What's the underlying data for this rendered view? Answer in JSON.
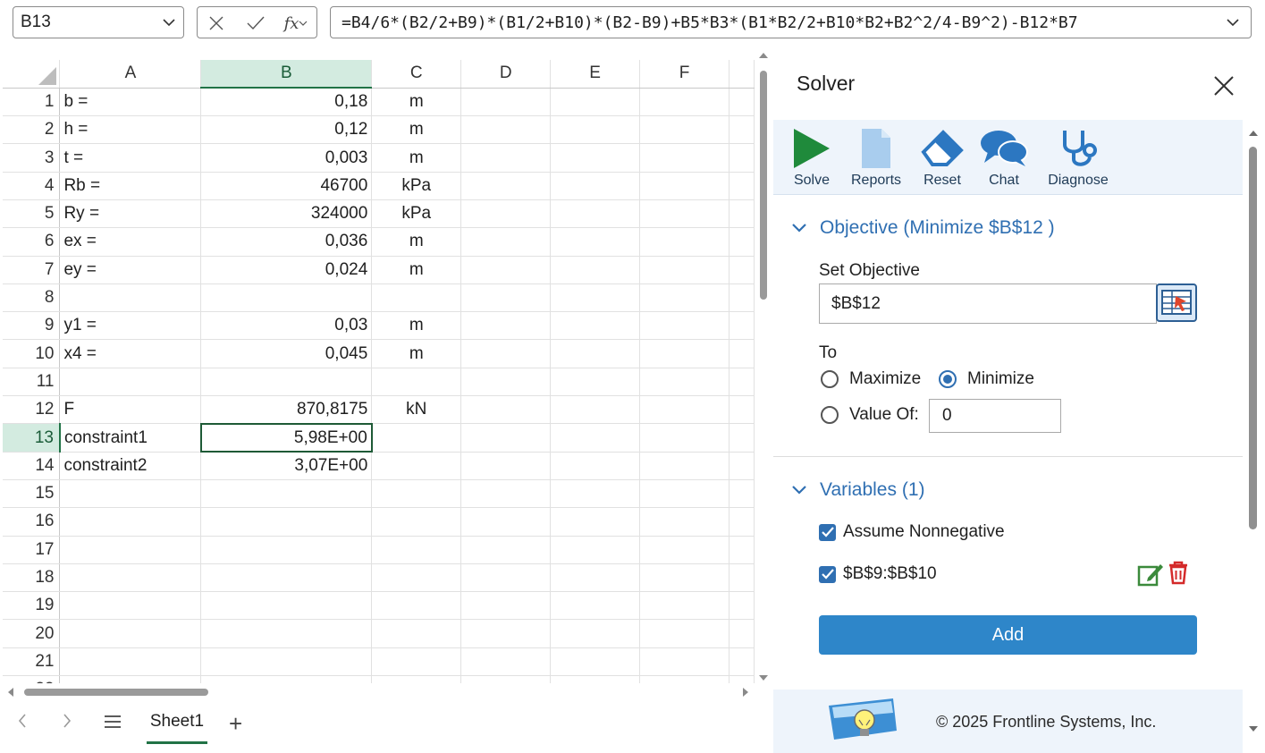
{
  "name_box": "B13",
  "formula_bar": {
    "fx_label": "fx",
    "formula": "=B4/6*(B2/2+B9)*(B1/2+B10)*(B2-B9)+B5*B3*(B1*B2/2+B10*B2+B2^2/4-B9^2)-B12*B7"
  },
  "grid": {
    "columns": [
      "A",
      "B",
      "C",
      "D",
      "E",
      "F"
    ],
    "selected_column": "B",
    "selected_row": 13,
    "rows": [
      {
        "n": "1",
        "a": "b =",
        "b": "0,18",
        "c": "m"
      },
      {
        "n": "2",
        "a": "h =",
        "b": "0,12",
        "c": "m"
      },
      {
        "n": "3",
        "a": "t =",
        "b": "0,003",
        "c": "m"
      },
      {
        "n": "4",
        "a": "Rb =",
        "b": "46700",
        "c": "kPa"
      },
      {
        "n": "5",
        "a": "Ry =",
        "b": "324000",
        "c": "kPa"
      },
      {
        "n": "6",
        "a": "ex =",
        "b": "0,036",
        "c": "m"
      },
      {
        "n": "7",
        "a": "ey =",
        "b": "0,024",
        "c": "m"
      },
      {
        "n": "8",
        "a": "",
        "b": "",
        "c": ""
      },
      {
        "n": "9",
        "a": "y1 =",
        "b": "0,03",
        "c": "m"
      },
      {
        "n": "10",
        "a": "x4 =",
        "b": "0,045",
        "c": "m"
      },
      {
        "n": "11",
        "a": "",
        "b": "",
        "c": ""
      },
      {
        "n": "12",
        "a": "F",
        "b": "870,8175",
        "c": "kN"
      },
      {
        "n": "13",
        "a": "constraint1",
        "b": "5,98E+00",
        "c": ""
      },
      {
        "n": "14",
        "a": "constraint2",
        "b": "3,07E+00",
        "c": ""
      },
      {
        "n": "15",
        "a": "",
        "b": "",
        "c": ""
      },
      {
        "n": "16",
        "a": "",
        "b": "",
        "c": ""
      },
      {
        "n": "17",
        "a": "",
        "b": "",
        "c": ""
      },
      {
        "n": "18",
        "a": "",
        "b": "",
        "c": ""
      },
      {
        "n": "19",
        "a": "",
        "b": "",
        "c": ""
      },
      {
        "n": "20",
        "a": "",
        "b": "",
        "c": ""
      },
      {
        "n": "21",
        "a": "",
        "b": "",
        "c": ""
      },
      {
        "n": "22",
        "a": "",
        "b": "",
        "c": ""
      }
    ]
  },
  "sheet_tabs": {
    "active": "Sheet1",
    "add": "+"
  },
  "solver": {
    "title": "Solver",
    "toolbar": [
      "Solve",
      "Reports",
      "Reset",
      "Chat",
      "Diagnose"
    ],
    "objective_header": "Objective (Minimize $B$12 )",
    "set_objective_label": "Set Objective",
    "objective_value": "$B$12",
    "to_label": "To",
    "maximize": "Maximize",
    "minimize": "Minimize",
    "value_of": "Value Of:",
    "value_of_input": "0",
    "variables_header": "Variables (1)",
    "assume_nonnegative": "Assume Nonnegative",
    "variable_range": "$B$9:$B$10",
    "add_button": "Add",
    "copyright": "© 2025 Frontline Systems, Inc."
  },
  "colors": {
    "accent_green": "#217346",
    "solver_blue": "#2f6fb2",
    "add_button": "#2e86c9"
  }
}
